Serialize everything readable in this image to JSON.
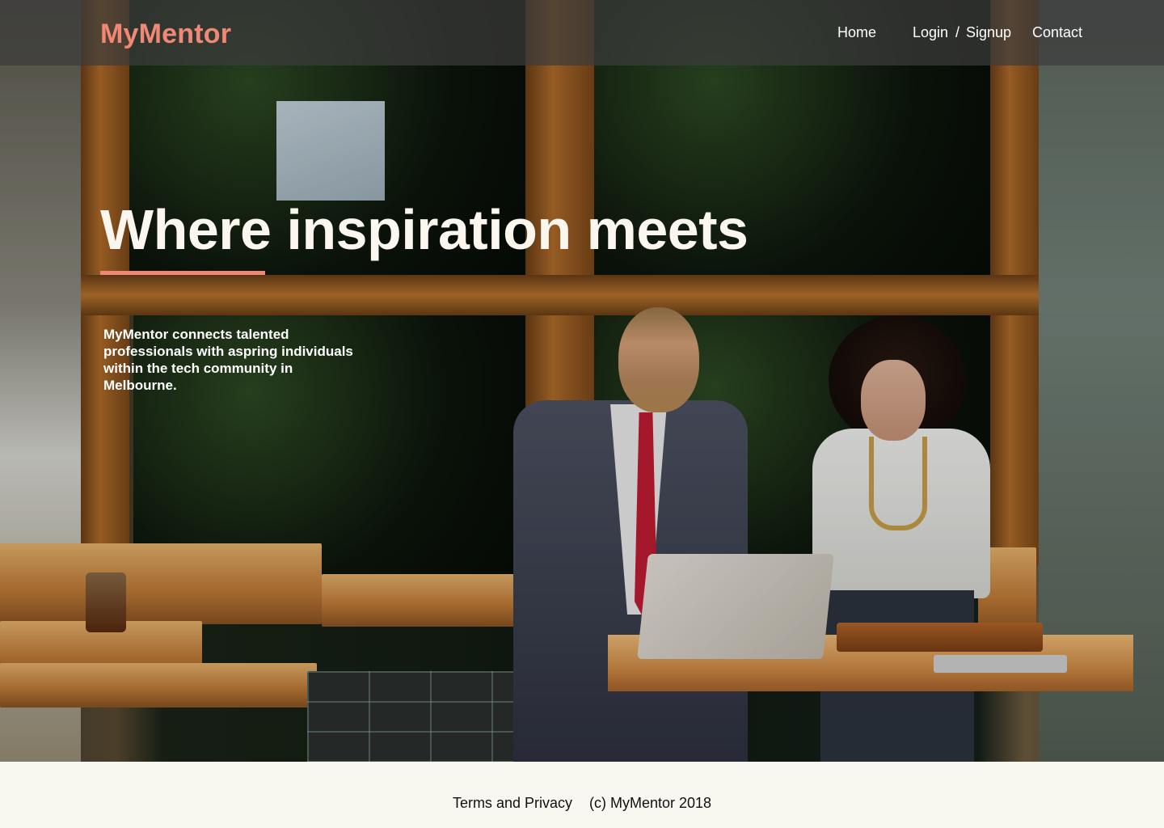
{
  "header": {
    "logo": "MyMentor",
    "nav": {
      "home": "Home",
      "login": "Login",
      "separator": "/",
      "signup": "Signup",
      "contact": "Contact"
    }
  },
  "hero": {
    "headline": "Where inspiration meets",
    "tagline": "MyMentor connects talented professionals with aspring individuals within the tech community in Melbourne."
  },
  "footer": {
    "terms": "Terms and Privacy",
    "copyright": "(c) MyMentor 2018"
  },
  "colors": {
    "accent": "#f08875",
    "header_bg": "#3c3c3c",
    "footer_bg": "#f8f7f0",
    "hero_text": "#fbf6ee"
  }
}
